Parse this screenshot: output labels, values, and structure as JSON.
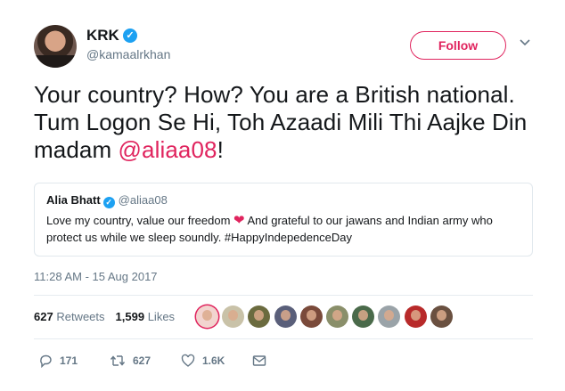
{
  "author": {
    "name": "KRK",
    "verified_glyph": "✓",
    "handle": "@kamaalrkhan"
  },
  "follow_button": {
    "label": "Follow"
  },
  "caret_icon": "chevron-down-icon",
  "tweet": {
    "text_before": "Your country? How? You are a British national. Tum Logon Se Hi, Toh Azaadi Mili Thi Aajke Din madam ",
    "mention": "@aliaa08",
    "text_after": "!"
  },
  "quoted_tweet": {
    "name": "Alia Bhatt",
    "verified_glyph": "✓",
    "handle": "@aliaa08",
    "text_before_heart": "Love my country, value our freedom ",
    "heart": "❤",
    "text_after_heart": " And grateful to our jawans and Indian army who protect us while we sleep soundly. #HappyIndepedenceDay"
  },
  "timestamp": "11:28 AM - 15 Aug 2017",
  "stats": {
    "retweets_count": "627",
    "retweets_label": "Retweets",
    "likes_count": "1,599",
    "likes_label": "Likes"
  },
  "liker_faces": [
    {
      "color": "#f2d4cf",
      "border": "#e0245e"
    },
    {
      "color": "#c9c2a8"
    },
    {
      "color": "#6b6b3f"
    },
    {
      "color": "#5a5f7a"
    },
    {
      "color": "#7a4a3a"
    },
    {
      "color": "#8a8f6a"
    },
    {
      "color": "#4a6a4a"
    },
    {
      "color": "#9aa3a8"
    },
    {
      "color": "#b82a2a"
    },
    {
      "color": "#6a5040"
    }
  ],
  "actions": {
    "reply_count": "171",
    "retweet_count": "627",
    "like_count": "1.6K"
  },
  "colors": {
    "accent_pink": "#e0245e",
    "verified_blue": "#1da1f2",
    "muted_text": "#657786"
  }
}
